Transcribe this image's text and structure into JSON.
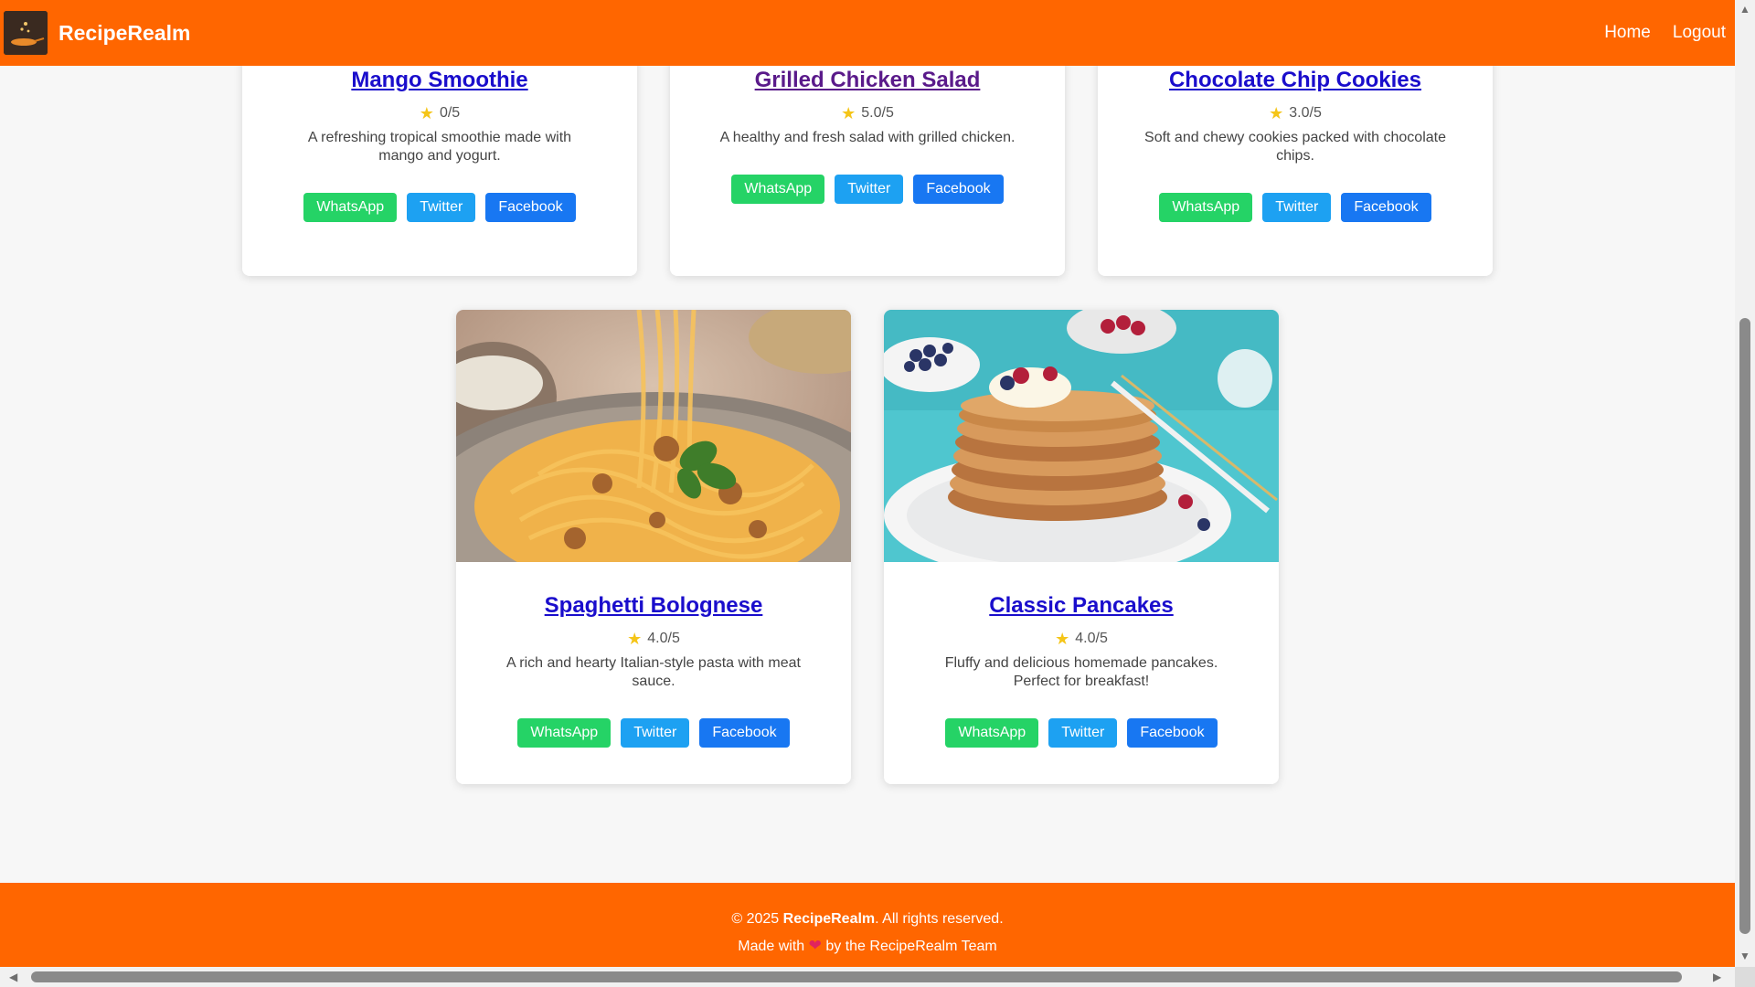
{
  "navbar": {
    "brand": "RecipeRealm",
    "links": [
      "Home",
      "Logout"
    ]
  },
  "recipes": [
    {
      "title": "Mango Smoothie",
      "rating": "0/5",
      "description": "A refreshing tropical smoothie made with mango and yogurt."
    },
    {
      "title": "Grilled Chicken Salad",
      "rating": "5.0/5",
      "description": "A healthy and fresh salad with grilled chicken."
    },
    {
      "title": "Chocolate Chip Cookies",
      "rating": "3.0/5",
      "description": "Soft and chewy cookies packed with chocolate chips."
    },
    {
      "title": "Spaghetti Bolognese",
      "rating": "4.0/5",
      "description": "A rich and hearty Italian-style pasta with meat sauce."
    },
    {
      "title": "Classic Pancakes",
      "rating": "4.0/5",
      "description": "Fluffy and delicious homemade pancakes. Perfect for breakfast!"
    }
  ],
  "share": {
    "whatsapp": "WhatsApp",
    "twitter": "Twitter",
    "facebook": "Facebook"
  },
  "footer": {
    "copyright_prefix": "© 2025 ",
    "brand": "RecipeRealm",
    "copyright_suffix": ". All rights reserved.",
    "made_prefix": "Made with ",
    "made_suffix": " by the RecipeRealm Team"
  },
  "colors": {
    "primary": "#ff6600",
    "whatsapp": "#25d366",
    "twitter": "#1da1f2",
    "facebook": "#1877f2",
    "star": "#f5c518"
  },
  "icons": {
    "star": "star-icon",
    "heart": "heart-icon"
  }
}
